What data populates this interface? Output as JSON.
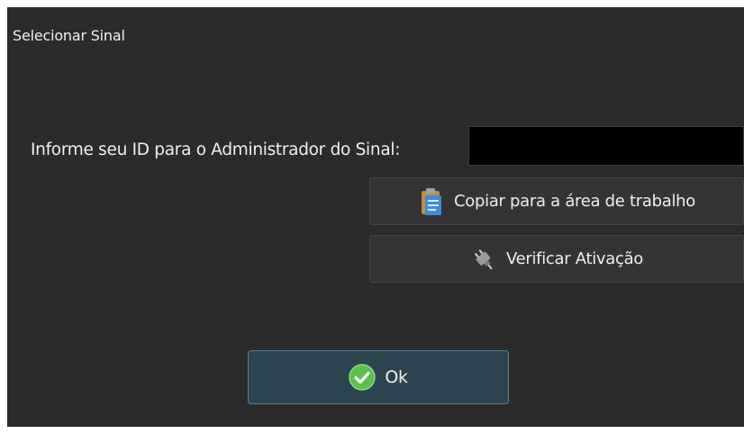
{
  "dialog": {
    "title": "Selecionar Sinal"
  },
  "id_section": {
    "label": "Informe seu ID para o Administrador do Sinal:",
    "field_value": ""
  },
  "buttons": {
    "copy": {
      "label": "Copiar para a área de trabalho",
      "icon": "clipboard-icon"
    },
    "verify": {
      "label": "Verificar Ativação",
      "icon": "plug-icon"
    },
    "ok": {
      "label": "Ok",
      "icon": "check-circle-icon"
    }
  },
  "colors": {
    "dialog_background": "#2b2b2b",
    "button_background": "#343434",
    "ok_button_background": "#2d4450",
    "ok_button_border": "#5b8296",
    "check_green": "#5cbf4b",
    "clipboard_blue": "#3a8fd6"
  }
}
